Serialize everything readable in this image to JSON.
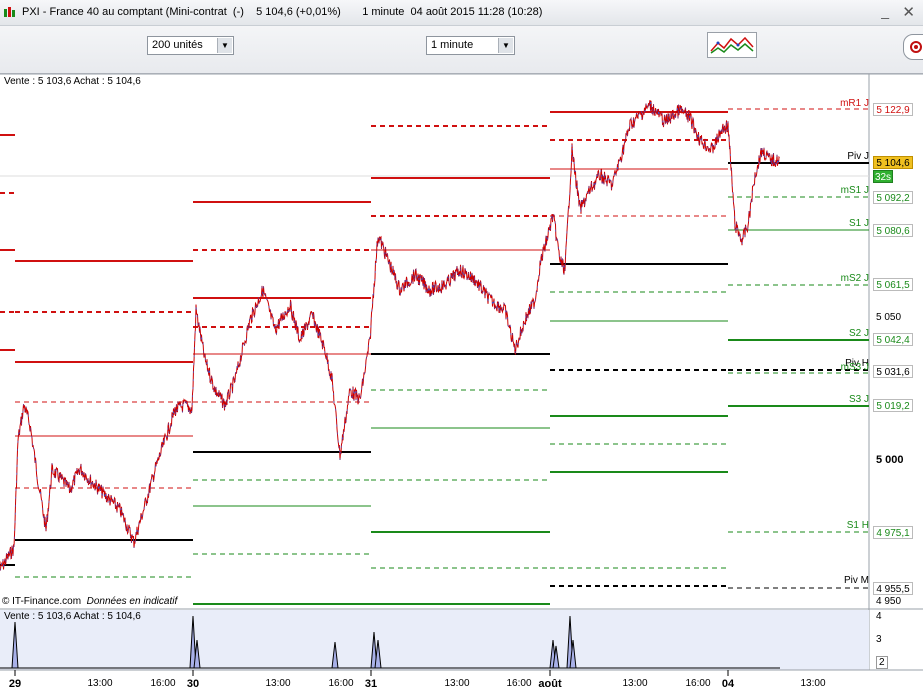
{
  "window": {
    "title": "PXI - France 40 au comptant (Mini-contrat  (-)    5 104,6 (+0,01%)       1 minute  04 août 2015 11:28 (10:28)"
  },
  "toolbar": {
    "units_select": "200 unités",
    "interval_select": "1 minute"
  },
  "chart": {
    "info_top": "Vente : 5 103,6 Achat : 5 104,6",
    "info_bottom": "Vente : 5 103,6 Achat : 5 104,6",
    "credit_source": "© IT-Finance.com",
    "credit_note": "Données en indicatif",
    "pivot_labels": {
      "mr1": "mR1 J",
      "piv": "Piv J",
      "ms1": "mS1 J",
      "s1": "S1 J",
      "ms2": "mS2 J",
      "s2": "S2 J",
      "piv_h": "Piv H",
      "ms3": "mS3 J",
      "s3": "S3 J",
      "s1h": "S1 H",
      "pivm": "Piv M"
    },
    "price_boxes": {
      "mr1": "5 122,9",
      "current": "5 104,6",
      "countdown": "32s",
      "ms1": "5 092,2",
      "s1": "5 080,6",
      "ms2": "5 061,5",
      "s2": "5 042,4",
      "piv_h": "5 031,6",
      "s3": "5 019,2",
      "s1h": "4 975,1",
      "pivm": "4 955,5"
    },
    "y_axis": {
      "t5050": "5 050",
      "t5000": "5 000",
      "t4950": "4 950",
      "vol4": "4",
      "vol3": "3",
      "vol2": "2"
    },
    "x_axis": {
      "d29": "29",
      "t1": "13:00",
      "t2": "16:00",
      "d30": "30",
      "t3": "13:00",
      "t4": "16:00",
      "d31": "31",
      "t5": "13:00",
      "t6": "16:00",
      "daout": "août",
      "t7": "13:00",
      "t8": "16:00",
      "d04": "04",
      "t9": "13:00"
    },
    "colors": {
      "resistance": "#d01010",
      "support": "#1a8a1a",
      "pivot": "#000000",
      "price_line": "#cc0000",
      "volume": "#a8b0e8"
    }
  }
}
